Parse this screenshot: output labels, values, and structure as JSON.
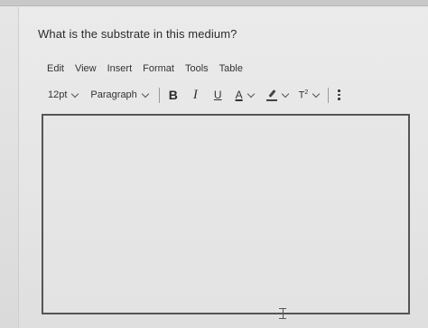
{
  "question": {
    "text": "What is the substrate in this medium?"
  },
  "menubar": {
    "items": [
      "Edit",
      "View",
      "Insert",
      "Format",
      "Tools",
      "Table"
    ]
  },
  "toolbar": {
    "font_size": "12pt",
    "block_format": "Paragraph",
    "bold_label": "B",
    "italic_label": "I",
    "underline_label": "U",
    "font_color_label": "A",
    "superscript_label": "T",
    "superscript_mark": "2",
    "icons": [
      "chevron-down-icon",
      "highlight-pen-icon",
      "more-options-icon"
    ]
  },
  "editor": {
    "content": ""
  }
}
